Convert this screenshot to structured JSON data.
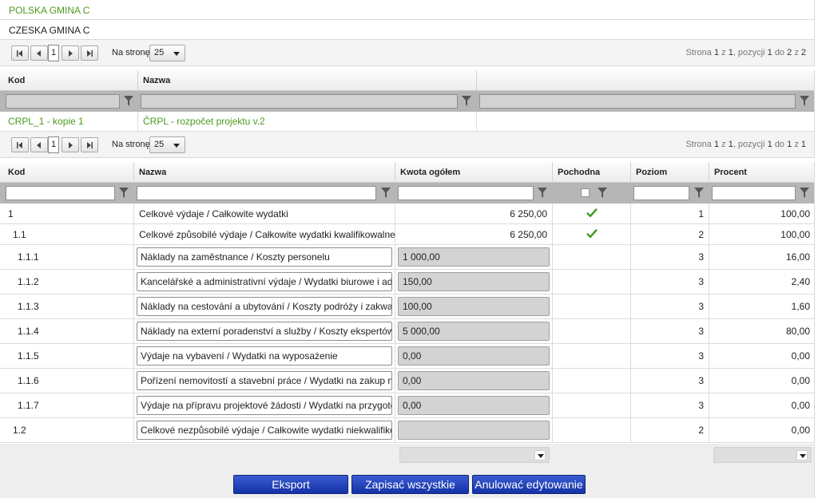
{
  "top_rows": [
    "POLSKA GMINA C",
    "CZESKA GMINA C"
  ],
  "pager1": {
    "page": "1",
    "per_page_label": "Na stronę",
    "per_page": "25",
    "info_prefix": "Strona",
    "info_page": "1",
    "info_of": "z",
    "info_pages": "1",
    "info_pos": ", pozycji",
    "info_from": "1",
    "info_do": "do",
    "info_to": "2",
    "info_z2": "z",
    "info_total": "2"
  },
  "table1": {
    "headers": {
      "kod": "Kod",
      "nazwa": "Nazwa",
      "extra": ""
    },
    "row": {
      "kod": "CRPL_1 - kopie 1",
      "nazwa": "ČRPL - rozpočet projektu v.2"
    }
  },
  "pager2": {
    "page": "1",
    "per_page_label": "Na stronę",
    "per_page": "25",
    "info_prefix": "Strona",
    "info_page": "1",
    "info_of": "z",
    "info_pages": "1",
    "info_pos": ", pozycji",
    "info_from": "1",
    "info_do": "do",
    "info_to": "1",
    "info_z2": "z",
    "info_total": "1"
  },
  "table2": {
    "headers": {
      "kod": "Kod",
      "nazwa": "Nazwa",
      "kwota": "Kwota ogółem",
      "pochodna": "Pochodna",
      "poziom": "Poziom",
      "procent": "Procent"
    },
    "rows": [
      {
        "kod": "1",
        "nazwa": "Celkové výdaje / Całkowite wydatki",
        "kwota": "6 250,00",
        "pochodna": true,
        "poziom": "1",
        "procent": "100,00",
        "editable": false
      },
      {
        "kod": "1.1",
        "nazwa": "Celkové způsobilé výdaje / Całkowite wydatki kwalifikowalne",
        "kwota": "6 250,00",
        "pochodna": true,
        "poziom": "2",
        "procent": "100,00",
        "editable": false
      },
      {
        "kod": "1.1.1",
        "nazwa": "Náklady na zaměstnance / Koszty personelu",
        "kwota": "1 000,00",
        "pochodna": false,
        "poziom": "3",
        "procent": "16,00",
        "editable": true
      },
      {
        "kod": "1.1.2",
        "nazwa": "Kancelářské a administrativní výdaje / Wydatki biurowe i administracyjne",
        "kwota": "150,00",
        "pochodna": false,
        "poziom": "3",
        "procent": "2,40",
        "editable": true
      },
      {
        "kod": "1.1.3",
        "nazwa": "Náklady na cestování a ubytování / Koszty podróży i zakwaterowania",
        "kwota": "100,00",
        "pochodna": false,
        "poziom": "3",
        "procent": "1,60",
        "editable": true
      },
      {
        "kod": "1.1.4",
        "nazwa": "Náklady na externí poradenství a služby / Koszty ekspertów i usług zewnętrznych",
        "kwota": "5 000,00",
        "pochodna": false,
        "poziom": "3",
        "procent": "80,00",
        "editable": true
      },
      {
        "kod": "1.1.5",
        "nazwa": "Výdaje na vybavení / Wydatki na wyposażenie",
        "kwota": "0,00",
        "pochodna": false,
        "poziom": "3",
        "procent": "0,00",
        "editable": true
      },
      {
        "kod": "1.1.6",
        "nazwa": "Pořízení nemovitostí a stavební práce / Wydatki na zakup nieruchomości",
        "kwota": "0,00",
        "pochodna": false,
        "poziom": "3",
        "procent": "0,00",
        "editable": true
      },
      {
        "kod": "1.1.7",
        "nazwa": "Výdaje na přípravu projektové žádosti / Wydatki na przygotowanie",
        "kwota": "0,00",
        "pochodna": false,
        "poziom": "3",
        "procent": "0,00",
        "editable": true
      },
      {
        "kod": "1.2",
        "nazwa": "Celkové nezpůsobilé výdaje / Całkowite wydatki niekwalifikowalne",
        "kwota": "",
        "pochodna": false,
        "poziom": "2",
        "procent": "0,00",
        "editable": true
      }
    ]
  },
  "buttons": {
    "eksport": "Eksport",
    "zapisac": "Zapisać wszystkie",
    "anulowac": "Anulować edytowanie"
  },
  "colors": {
    "link_green": "#4c9a1c",
    "button_blue": "#1f3fbf"
  }
}
